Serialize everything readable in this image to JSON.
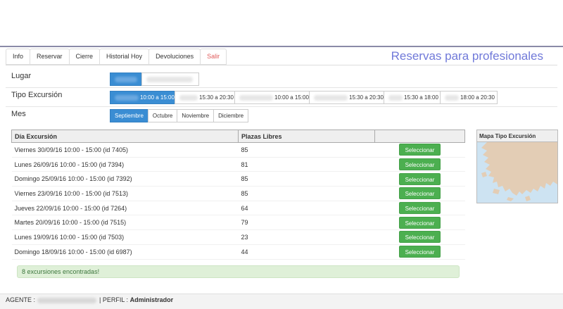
{
  "app_title": "Reservas para profesionales",
  "tabs": [
    {
      "label": "Info"
    },
    {
      "label": "Reservar"
    },
    {
      "label": "Cierre"
    },
    {
      "label": "Historial Hoy"
    },
    {
      "label": "Devoluciones"
    },
    {
      "label": "Salir"
    }
  ],
  "lugar": {
    "label": "Lugar"
  },
  "tipo": {
    "label": "Tipo Excursión",
    "options": [
      {
        "time": "10:00 a 15:00",
        "active": true
      },
      {
        "time": "15:30 a 20:30"
      },
      {
        "time": "10:00 a 15:00"
      },
      {
        "time": "15:30 a 20:30"
      },
      {
        "time": "15:30 a 18:00"
      },
      {
        "time": "18:00 a 20:30"
      }
    ]
  },
  "mes": {
    "label": "Mes",
    "options": [
      {
        "label": "Septiembre",
        "active": true
      },
      {
        "label": "Octubre"
      },
      {
        "label": "Noviembre"
      },
      {
        "label": "Diciembre"
      }
    ]
  },
  "table": {
    "headers": [
      "Día Excursión",
      "Plazas Libres",
      ""
    ],
    "button_label": "Seleccionar",
    "rows": [
      {
        "day": "Viernes 30/09/16 10:00 - 15:00 (id 7405)",
        "places": "85"
      },
      {
        "day": "Lunes 26/09/16 10:00 - 15:00 (id 7394)",
        "places": "81"
      },
      {
        "day": "Domingo 25/09/16 10:00 - 15:00 (id 7392)",
        "places": "85"
      },
      {
        "day": "Viernes 23/09/16 10:00 - 15:00 (id 7513)",
        "places": "85"
      },
      {
        "day": "Jueves 22/09/16 10:00 - 15:00 (id 7264)",
        "places": "64"
      },
      {
        "day": "Martes 20/09/16 10:00 - 15:00 (id 7515)",
        "places": "79"
      },
      {
        "day": "Lunes 19/09/16 10:00 - 15:00 (id 7503)",
        "places": "23"
      },
      {
        "day": "Domingo 18/09/16 10:00 - 15:00 (id 6987)",
        "places": "44"
      }
    ]
  },
  "map": {
    "title": "Mapa Tipo Excursión",
    "water_color": "#cde3f2",
    "land_color": "#e3cdb5"
  },
  "message": "8 excursiones encontradas!",
  "footer": {
    "agent_label": "AGENTE :",
    "profile_label": "| PERFIL :",
    "profile_value": "Administrador"
  },
  "colors": {
    "accent": "#3a8dd3",
    "success": "#4caf50",
    "title": "#7079d9",
    "exit": "#e05a5a"
  }
}
